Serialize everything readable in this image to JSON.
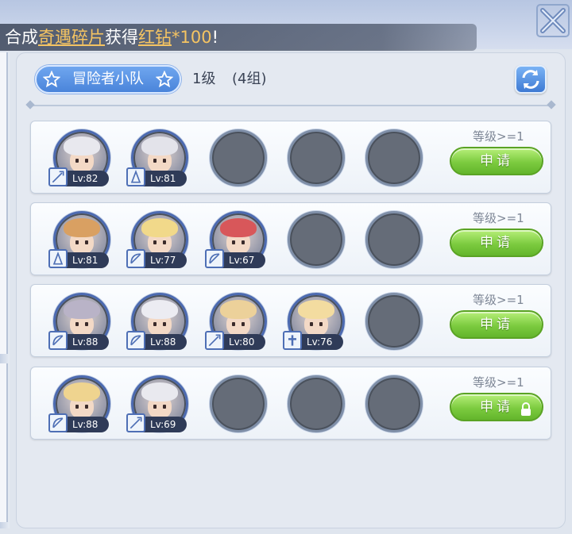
{
  "notice": {
    "prefix": "合成",
    "item1": "奇遇碎片",
    "middle": "获得",
    "item2": "红钻",
    "amount": "*100",
    "suffix": "!"
  },
  "header": {
    "team_name": "冒险者小队",
    "level": "1级",
    "groups": "(4组)"
  },
  "rows": [
    {
      "requirement": "等级>=1",
      "apply_label": "申请",
      "locked": false,
      "members": [
        {
          "level": "Lv:82",
          "hair": "#e8e8ee",
          "job": "sword"
        },
        {
          "level": "Lv:81",
          "hair": "#e3e3ea",
          "job": "mage"
        }
      ]
    },
    {
      "requirement": "等级>=1",
      "apply_label": "申请",
      "locked": false,
      "members": [
        {
          "level": "Lv:81",
          "hair": "#d9a062",
          "job": "mage"
        },
        {
          "level": "Lv:77",
          "hair": "#f1d98a",
          "job": "bow"
        },
        {
          "level": "Lv:67",
          "hair": "#d8575a",
          "job": "bow"
        }
      ]
    },
    {
      "requirement": "等级>=1",
      "apply_label": "申请",
      "locked": false,
      "members": [
        {
          "level": "Lv:88",
          "hair": "#b9b3c7",
          "job": "bow"
        },
        {
          "level": "Lv:88",
          "hair": "#ececf2",
          "job": "bow"
        },
        {
          "level": "Lv:80",
          "hair": "#ecd19a",
          "job": "sword"
        },
        {
          "level": "Lv:76",
          "hair": "#f3dca0",
          "job": "cross"
        }
      ]
    },
    {
      "requirement": "等级>=1",
      "apply_label": "申请",
      "locked": true,
      "members": [
        {
          "level": "Lv:88",
          "hair": "#efd48f",
          "job": "bow"
        },
        {
          "level": "Lv:69",
          "hair": "#e9e9ef",
          "job": "sword"
        }
      ]
    }
  ],
  "colors": {
    "accent_gold": "#f5c462",
    "apply_green": "#7ccb3f",
    "pill_blue": "#4a84da",
    "empty_slot": "#656c78"
  }
}
